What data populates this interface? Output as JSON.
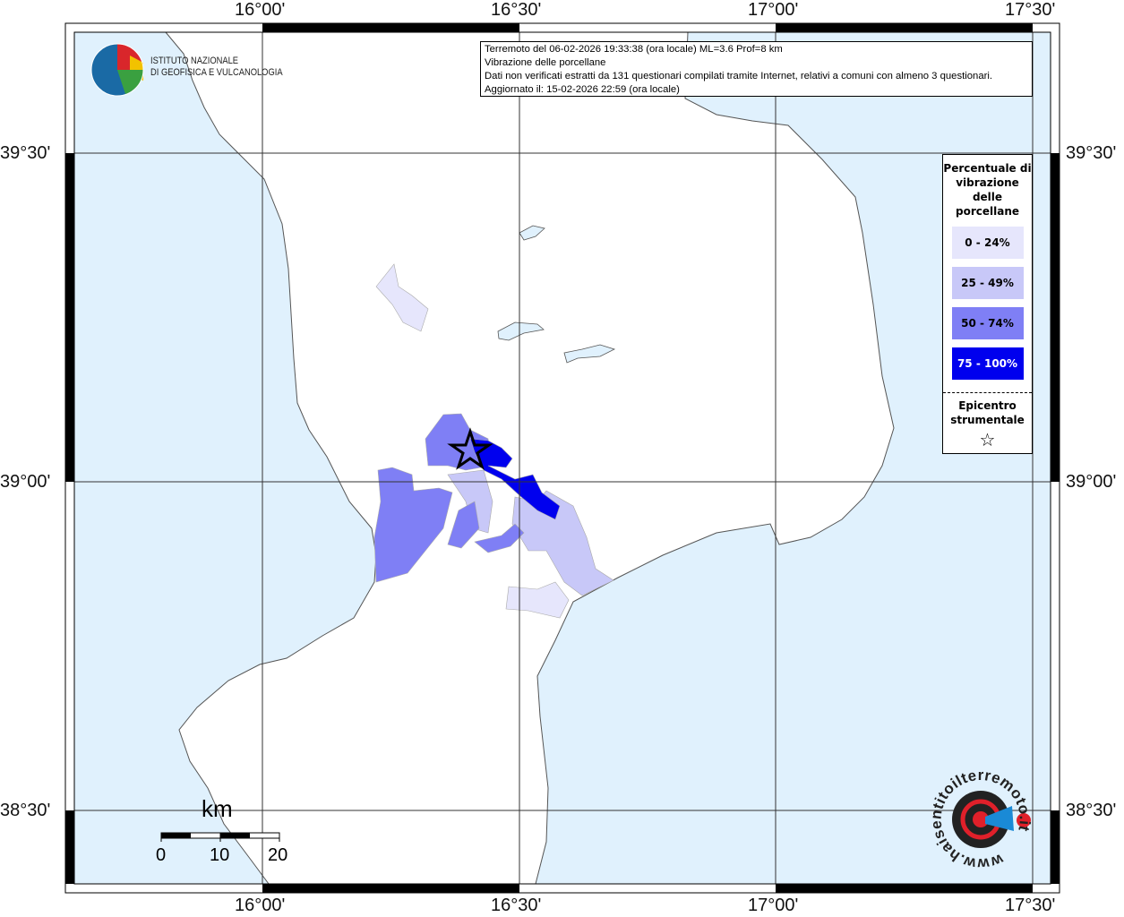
{
  "info_box": {
    "line1": "Terremoto del 06-02-2026 19:33:38 (ora locale) ML=3.6 Prof=8 km",
    "line2": "Vibrazione delle porcellane",
    "line3": "Dati non verificati estratti da 131 questionari compilati tramite Internet, relativi a comuni con almeno 3 questionari.",
    "line4": "Aggiornato il: 15-02-2026 22:59 (ora locale)"
  },
  "logo": {
    "line1": "ISTITUTO NAZIONALE",
    "line2": "DI GEOFISICA E VULCANOLOGIA"
  },
  "badge": {
    "text": "www.haisentitoilterremoto.it"
  },
  "axes": {
    "lon_ticks": [
      "16°00'",
      "16°30'",
      "17°00'",
      "17°30'"
    ],
    "lat_ticks": [
      "39°30'",
      "39°00'",
      "38°30'"
    ]
  },
  "legend": {
    "title": "Percentuale di vibrazione delle porcellane",
    "classes": [
      {
        "label": "0 - 24%",
        "color": "#e6e6fc"
      },
      {
        "label": "25 - 49%",
        "color": "#c8c8f8"
      },
      {
        "label": "50 - 74%",
        "color": "#7f7ff5"
      },
      {
        "label": "75 - 100%",
        "color": "#0000ee"
      }
    ],
    "epicenter_label": "Epicentro strumentale",
    "epicenter_symbol": "☆"
  },
  "scale_bar": {
    "unit": "km",
    "labels": [
      "0",
      "10",
      "20"
    ]
  },
  "colors": {
    "sea": "#e0f1fd",
    "land": "#ffffff"
  }
}
